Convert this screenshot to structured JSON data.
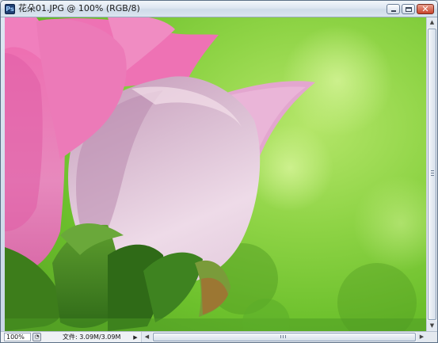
{
  "window": {
    "title": "花朵01.JPG @ 100% (RGB/8)",
    "app_icon_text": "Ps",
    "close_glyph": "✕"
  },
  "canvas": {
    "image_description_icon": "photo-rose-icon"
  },
  "statusbar": {
    "zoom": "100%",
    "doc_info": "文件: 3.09M/3.09M",
    "info_menu_glyph": "▶"
  },
  "scrollbars": {
    "up_glyph": "▲",
    "down_glyph": "▼",
    "left_glyph": "◀",
    "right_glyph": "▶"
  },
  "colors": {
    "background_green": "#7fcf3c",
    "petal_pink": "#e97ab5",
    "leaf_green": "#3f7d1f"
  }
}
